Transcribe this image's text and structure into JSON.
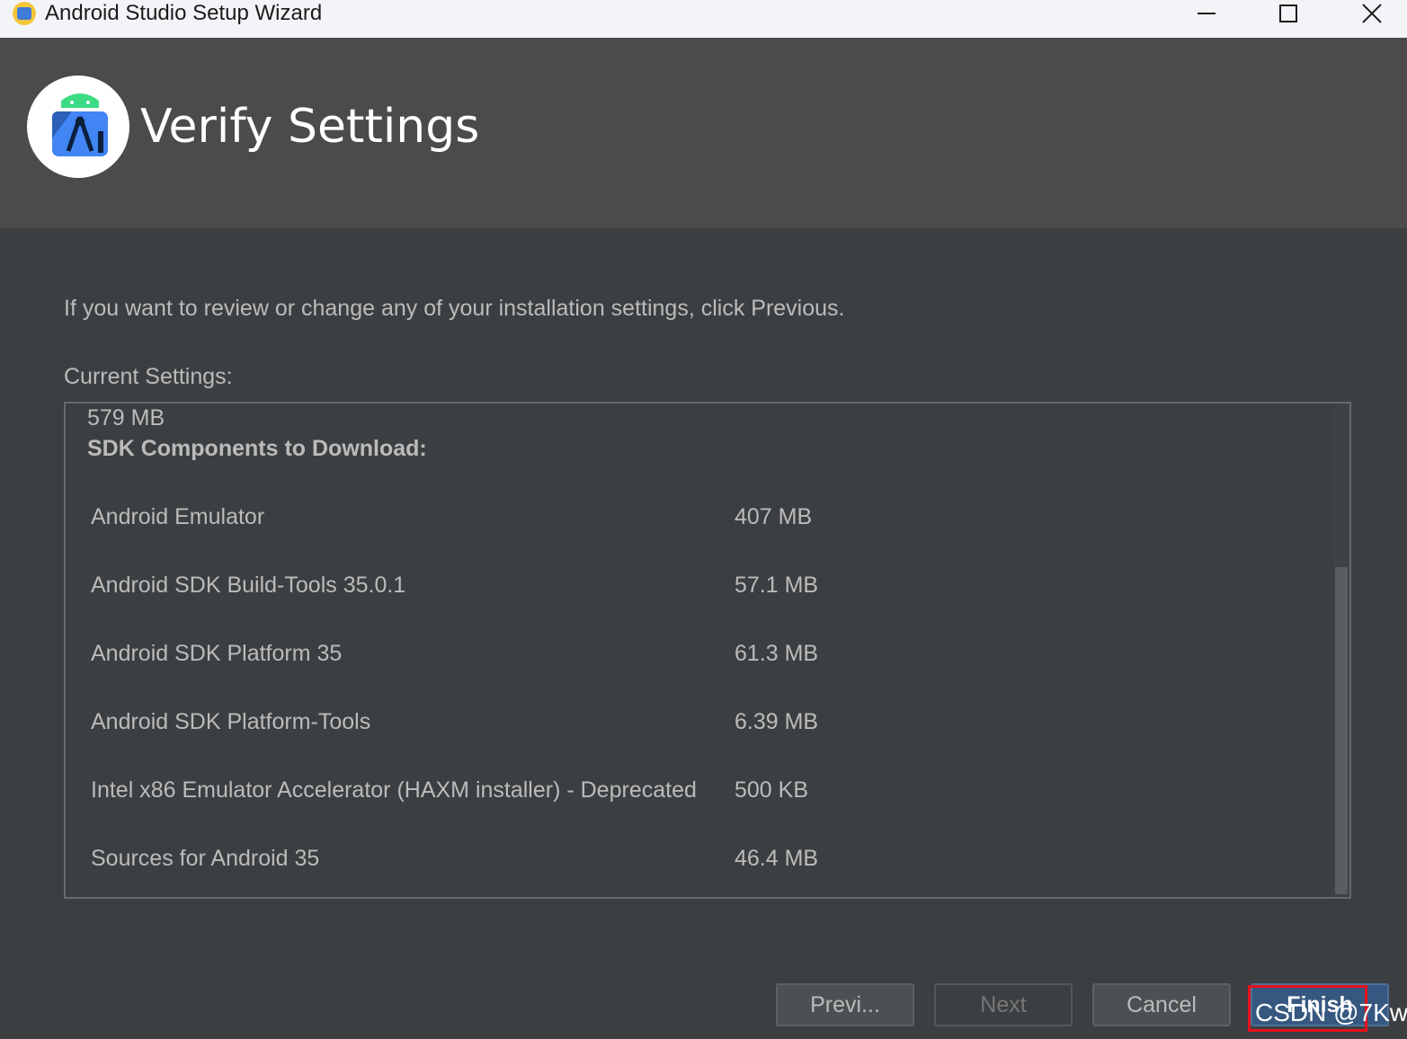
{
  "window": {
    "title": "Android Studio Setup Wizard",
    "controls": [
      "minimize",
      "maximize",
      "close"
    ]
  },
  "header": {
    "title": "Verify Settings",
    "logo_icon": "android-studio-logo-icon"
  },
  "main": {
    "intro": "If you want to review or change any of your installation settings, click Previous.",
    "current_settings_label": "Current Settings:",
    "top_size": "579 MB",
    "section_heading": "SDK Components to Download:",
    "components": [
      {
        "name": "Android Emulator",
        "size": "407 MB"
      },
      {
        "name": "Android SDK Build-Tools 35.0.1",
        "size": "57.1 MB"
      },
      {
        "name": "Android SDK Platform 35",
        "size": "61.3 MB"
      },
      {
        "name": "Android SDK Platform-Tools",
        "size": "6.39 MB"
      },
      {
        "name": "Intel x86 Emulator Accelerator (HAXM installer) - Deprecated",
        "size": "500 KB"
      },
      {
        "name": "Sources for Android 35",
        "size": "46.4 MB"
      }
    ]
  },
  "buttons": {
    "previous": "Previ...",
    "next": "Next",
    "cancel": "Cancel",
    "finish": "Finish"
  },
  "watermark": "CSDN @7Kw",
  "colors": {
    "background": "#3c3f41",
    "header": "#4b4b4b",
    "finish_button": "#365880",
    "highlight": "#e8101a"
  }
}
